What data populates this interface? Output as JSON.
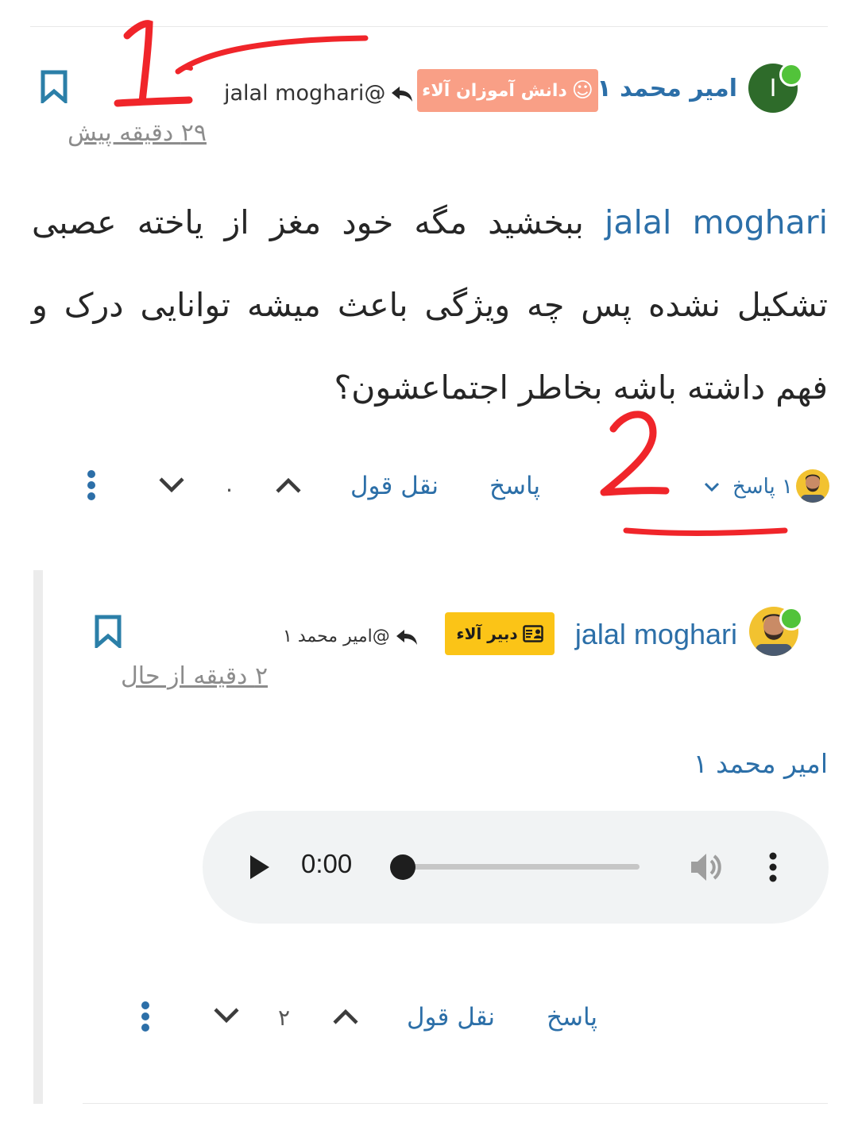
{
  "post": {
    "author": "امیر محمد ۱",
    "avatar_letter": "I",
    "badge_label": "دانش آموزان آلاء",
    "badge_icon": "smiley-icon",
    "reply_to": "jalal moghari@",
    "timestamp": "۲۹ دقیقه پیش",
    "body_mention": "jalal moghari",
    "body_text": " ببخشید مگه خود مغز از یاخته عصبی تشکیل نشده پس چه ویژگی باعث میشه توانایی درک و فهم داشته باشه بخاطر اجتماعشون؟",
    "actions": {
      "reply_label": "پاسخ",
      "quote_label": "نقل قول",
      "vote_count": "۰",
      "replies_toggle": "۱ پاسخ"
    }
  },
  "reply": {
    "author": "jalal moghari",
    "badge_label": "دبیر آلاء",
    "badge_icon": "id-card-icon",
    "reply_to": "@امیر محمد ۱",
    "timestamp": "۲ دقیقه از حال",
    "body": "امیر محمد ۱",
    "audio": {
      "time": "0:00",
      "progress": 0
    },
    "actions": {
      "reply_label": "پاسخ",
      "quote_label": "نقل قول",
      "vote_count": "۲"
    }
  },
  "annotations": {
    "mark_1": "1",
    "mark_2": "2",
    "color": "#f0252a"
  },
  "colors": {
    "link": "#2c6fa8",
    "student_badge": "#f99f86",
    "teacher_badge": "#fbc417",
    "online": "#52c33a",
    "bookmark": "#2b7fa8"
  }
}
